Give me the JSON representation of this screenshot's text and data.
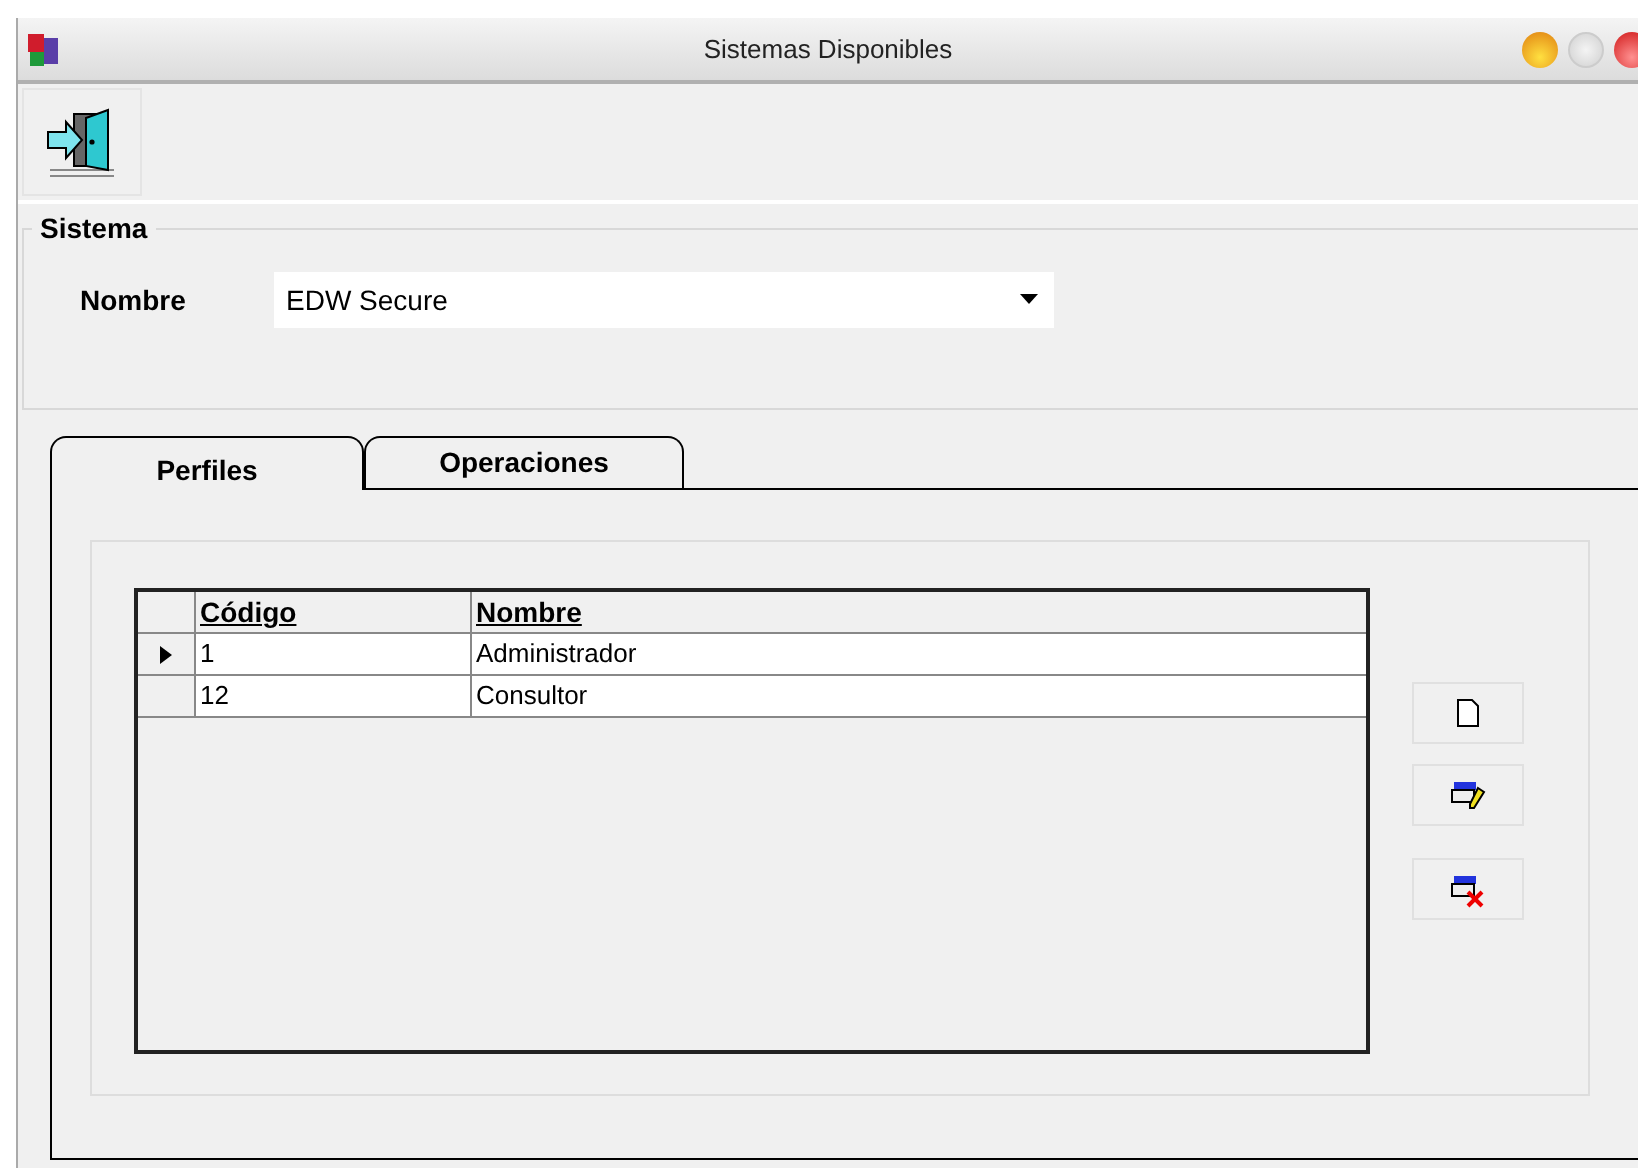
{
  "window": {
    "title": "Sistemas Disponibles"
  },
  "group": {
    "title": "Sistema",
    "field_label": "Nombre",
    "value": "EDW Secure"
  },
  "tabs": [
    {
      "label": "Perfiles",
      "selected": true
    },
    {
      "label": "Operaciones",
      "selected": false
    }
  ],
  "table": {
    "columns": [
      "Código",
      "Nombre"
    ],
    "rows": [
      {
        "cells": [
          "1",
          "Administrador"
        ],
        "selected": true
      },
      {
        "cells": [
          "12",
          "Consultor"
        ],
        "selected": false
      }
    ]
  },
  "side_buttons": [
    {
      "kind": "new"
    },
    {
      "kind": "edit"
    },
    {
      "kind": "delete"
    }
  ]
}
